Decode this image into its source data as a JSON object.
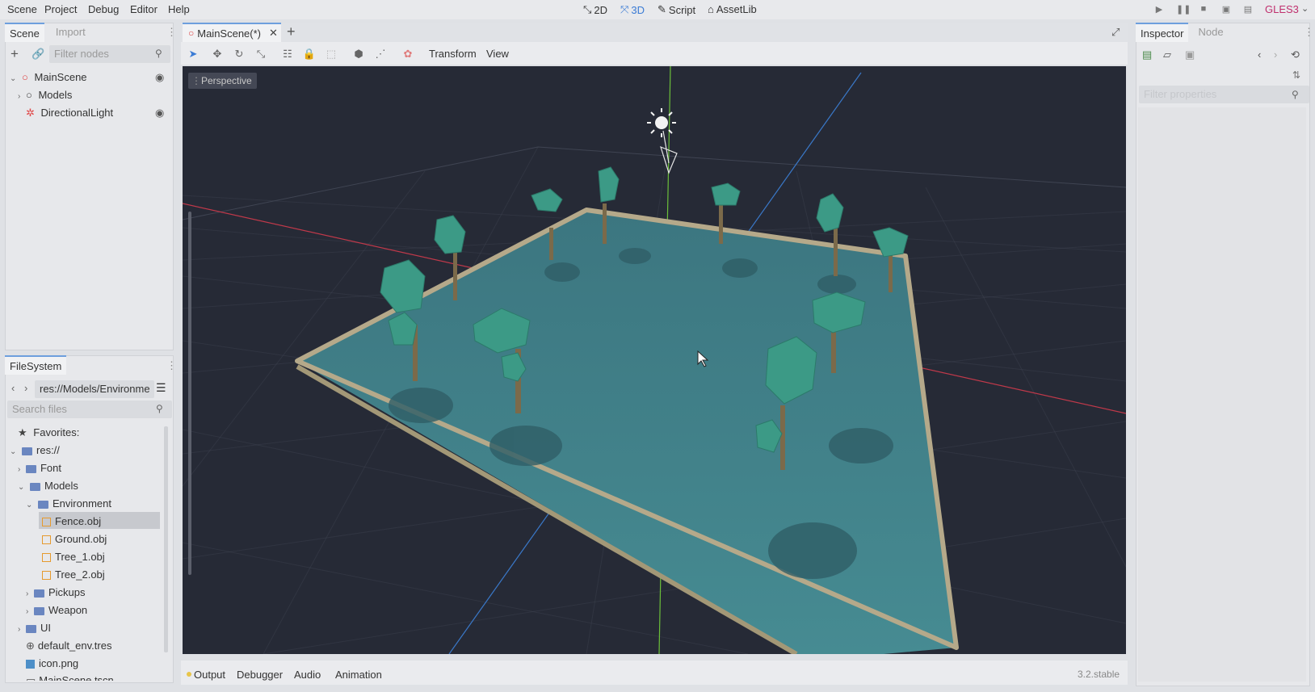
{
  "menu": [
    "Scene",
    "Project",
    "Debug",
    "Editor",
    "Help"
  ],
  "modes": [
    {
      "label": "2D",
      "icon": "2d-icon"
    },
    {
      "label": "3D",
      "icon": "3d-icon"
    },
    {
      "label": "Script",
      "icon": "script-icon"
    },
    {
      "label": "AssetLib",
      "icon": "assetlib-icon"
    }
  ],
  "renderer": "GLES3",
  "scene_panel": {
    "tabs": [
      "Scene",
      "Import"
    ],
    "filter_placeholder": "Filter nodes",
    "nodes": [
      "MainScene",
      "Models",
      "DirectionalLight"
    ]
  },
  "filesystem": {
    "tab": "FileSystem",
    "path": "res://Models/Environme",
    "search_placeholder": "Search files",
    "items": [
      "Favorites:",
      "res://",
      "Font",
      "Models",
      "Environment",
      "Fence.obj",
      "Ground.obj",
      "Tree_1.obj",
      "Tree_2.obj",
      "Pickups",
      "Weapon",
      "UI",
      "default_env.tres",
      "icon.png",
      "MainScene.tscn"
    ]
  },
  "editor": {
    "tab": "MainScene(*)",
    "menus": [
      "Transform",
      "View"
    ],
    "perspective": "Perspective"
  },
  "inspector": {
    "tabs": [
      "Inspector",
      "Node"
    ],
    "filter_placeholder": "Filter properties"
  },
  "bottom": {
    "tabs": [
      "Output",
      "Debugger",
      "Audio",
      "Animation"
    ],
    "version": "3.2.stable"
  },
  "colors": {
    "accent": "#3a7bd5",
    "viewport_bg": "#262a36",
    "ground": "#3f7f86",
    "tree": "#3c9a86",
    "fence": "#b5a98a"
  }
}
